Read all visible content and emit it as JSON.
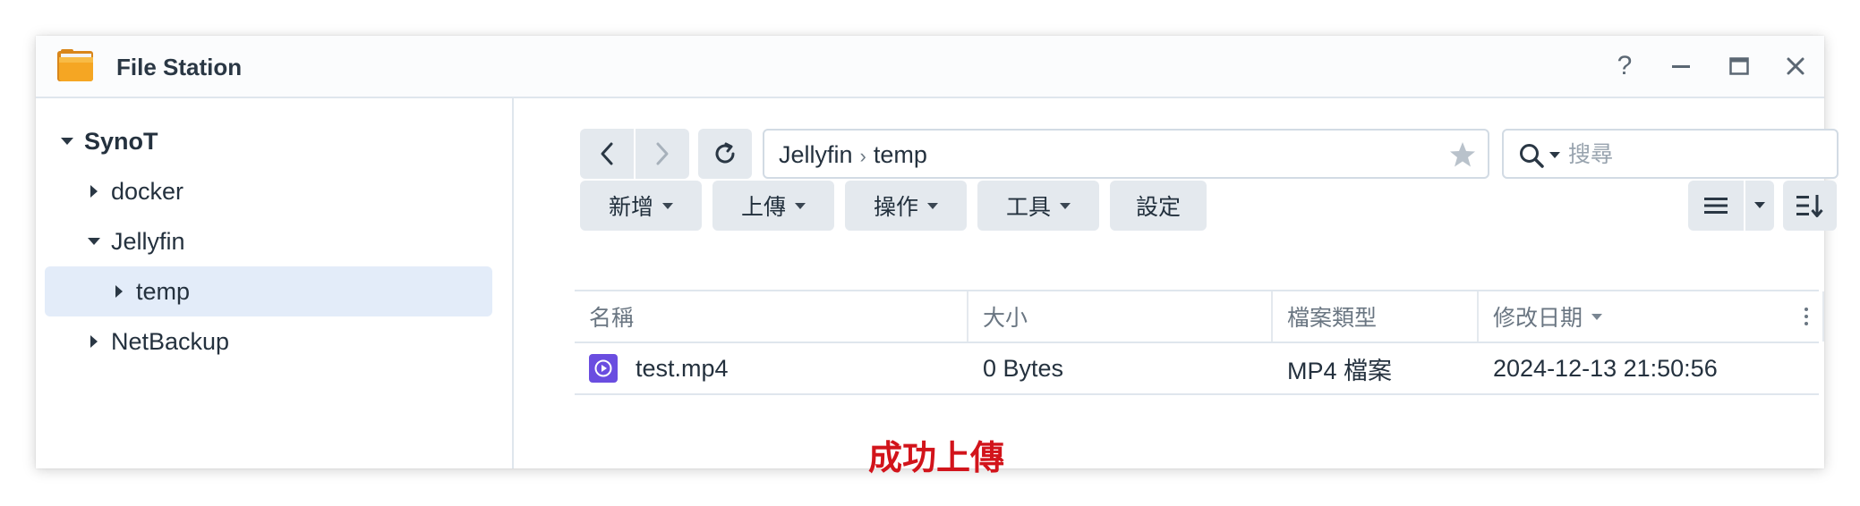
{
  "window": {
    "title": "File Station",
    "controls": {
      "help": "?"
    }
  },
  "sidebar": {
    "items": [
      {
        "label": "SynoT",
        "expanded": true,
        "level": 0
      },
      {
        "label": "docker",
        "expanded": false,
        "level": 1
      },
      {
        "label": "Jellyfin",
        "expanded": true,
        "level": 1
      },
      {
        "label": "temp",
        "expanded": false,
        "level": 2,
        "selected": true
      },
      {
        "label": "NetBackup",
        "expanded": false,
        "level": 1
      }
    ]
  },
  "toolbar": {
    "path": [
      "Jellyfin",
      "temp"
    ],
    "search_placeholder": "搜尋",
    "buttons": {
      "create": "新增",
      "upload": "上傳",
      "action": "操作",
      "tools": "工具",
      "settings": "設定"
    }
  },
  "table": {
    "columns": {
      "name": "名稱",
      "size": "大小",
      "type": "檔案類型",
      "modified": "修改日期"
    },
    "rows": [
      {
        "name": "test.mp4",
        "size": "0 Bytes",
        "type": "MP4 檔案",
        "modified": "2024-12-13 21:50:56"
      }
    ]
  },
  "status_message": "成功上傳",
  "colors": {
    "accent_selected": "#e3ecf9",
    "status_text": "#d2141b",
    "video_icon": "#6a4de0",
    "folder_icon": "#f5a623"
  },
  "icons": [
    "folder-app-icon",
    "help-icon",
    "minimize-icon",
    "maximize-icon",
    "close-icon",
    "back-icon",
    "forward-icon",
    "refresh-icon",
    "star-icon",
    "search-icon",
    "list-view-icon",
    "sort-icon",
    "video-file-icon"
  ]
}
